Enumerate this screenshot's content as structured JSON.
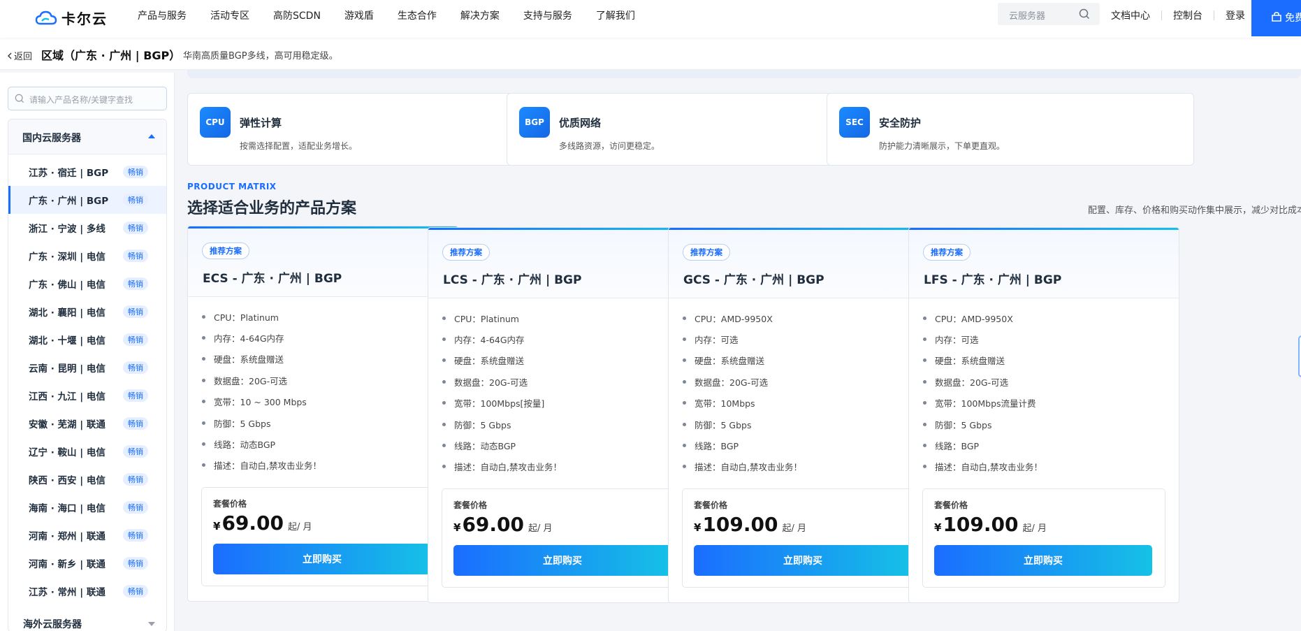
{
  "brand": {
    "name": "卡尔云"
  },
  "nav": {
    "items": [
      "产品与服务",
      "活动专区",
      "高防SCDN",
      "游戏盾",
      "生态合作",
      "解决方案",
      "支持与服务",
      "了解我们"
    ],
    "search_placeholder": "云服务器",
    "links": [
      "文档中心",
      "控制台",
      "登录"
    ],
    "free_label": "免费"
  },
  "titlebar": {
    "back": "返回",
    "title": "区域（广东 · 广州 | BGP）",
    "subtitle": "华南高质量BGP多线，高可用稳定级。"
  },
  "sidebar": {
    "search_placeholder": "请输入产品名称/关键字查找",
    "group_title": "国内云服务器",
    "items": [
      {
        "name": "江苏 · 宿迁 | BGP",
        "badge": "畅销"
      },
      {
        "name": "广东 · 广州 | BGP",
        "badge": "畅销"
      },
      {
        "name": "浙江 · 宁波 | 多线",
        "badge": "畅销"
      },
      {
        "name": "广东 · 深圳 | 电信",
        "badge": "畅销"
      },
      {
        "name": "广东 · 佛山 | 电信",
        "badge": "畅销"
      },
      {
        "name": "湖北 · 襄阳 | 电信",
        "badge": "畅销"
      },
      {
        "name": "湖北 · 十堰 | 电信",
        "badge": "畅销"
      },
      {
        "name": "云南 · 昆明 | 电信",
        "badge": "畅销"
      },
      {
        "name": "江西 · 九江 | 电信",
        "badge": "畅销"
      },
      {
        "name": "安徽 · 芜湖 | 联通",
        "badge": "畅销"
      },
      {
        "name": "辽宁 · 鞍山 | 电信",
        "badge": "畅销"
      },
      {
        "name": "陕西 · 西安 | 电信",
        "badge": "畅销"
      },
      {
        "name": "海南 · 海口 | 电信",
        "badge": "畅销"
      },
      {
        "name": "河南 · 郑州 | 联通",
        "badge": "畅销"
      },
      {
        "name": "河南 · 新乡 | 联通",
        "badge": "畅销"
      },
      {
        "name": "江苏 · 常州 | 联通",
        "badge": "畅销"
      }
    ],
    "active_index": 1,
    "overseas_title": "海外云服务器"
  },
  "features": [
    {
      "icon": "CPU",
      "title": "弹性计算",
      "desc": "按需选择配置，适配业务增长。"
    },
    {
      "icon": "BGP",
      "title": "优质网络",
      "desc": "多线路资源，访问更稳定。"
    },
    {
      "icon": "SEC",
      "title": "安全防护",
      "desc": "防护能力清晰展示，下单更直观。"
    }
  ],
  "section": {
    "eyebrow": "PRODUCT MATRIX",
    "title": "选择适合业务的产品方案",
    "subtitle": "配置、库存、价格和购买动作集中展示，减少对比成本"
  },
  "cards": [
    {
      "tag": "推荐方案",
      "title": "ECS - 广东 · 广州 | BGP",
      "specs": [
        "CPU：Platinum",
        "内存：4-64G内存",
        "硬盘：系统盘赠送",
        "数据盘：20G-可选",
        "宽带：10 ~ 300 Mbps",
        "防御：5 Gbps",
        "线路：动态BGP",
        "描述：自动白,禁攻击业务！"
      ],
      "price_label": "套餐价格",
      "currency": "¥",
      "price": "69.00",
      "unit": "起/ 月",
      "buy": "立即购买"
    },
    {
      "tag": "推荐方案",
      "title": "LCS - 广东 · 广州 | BGP",
      "specs": [
        "CPU：Platinum",
        "内存：4-64G内存",
        "硬盘：系统盘赠送",
        "数据盘：20G-可选",
        "宽带：100Mbps[按量]",
        "防御：5 Gbps",
        "线路：动态BGP",
        "描述：自动白,禁攻击业务！"
      ],
      "price_label": "套餐价格",
      "currency": "¥",
      "price": "69.00",
      "unit": "起/ 月",
      "buy": "立即购买"
    },
    {
      "tag": "推荐方案",
      "title": "GCS - 广东 · 广州 | BGP",
      "specs": [
        "CPU：AMD-9950X",
        "内存：可选",
        "硬盘：系统盘赠送",
        "数据盘：20G-可选",
        "宽带：10Mbps",
        "防御：5 Gbps",
        "线路：BGP",
        "描述：自动白,禁攻击业务！"
      ],
      "price_label": "套餐价格",
      "currency": "¥",
      "price": "109.00",
      "unit": "起/ 月",
      "buy": "立即购买"
    },
    {
      "tag": "推荐方案",
      "title": "LFS - 广东 · 广州 | BGP",
      "specs": [
        "CPU：AMD-9950X",
        "内存：可选",
        "硬盘：系统盘赠送",
        "数据盘：20G-可选",
        "宽带：100Mbps流量计费",
        "防御：5 Gbps",
        "线路：BGP",
        "描述：自动白,禁攻击业务！"
      ],
      "price_label": "套餐价格",
      "currency": "¥",
      "price": "109.00",
      "unit": "起/ 月",
      "buy": "立即购买"
    }
  ],
  "colors": {
    "accent": "#1b6dff",
    "accent_end": "#15c1e6"
  }
}
